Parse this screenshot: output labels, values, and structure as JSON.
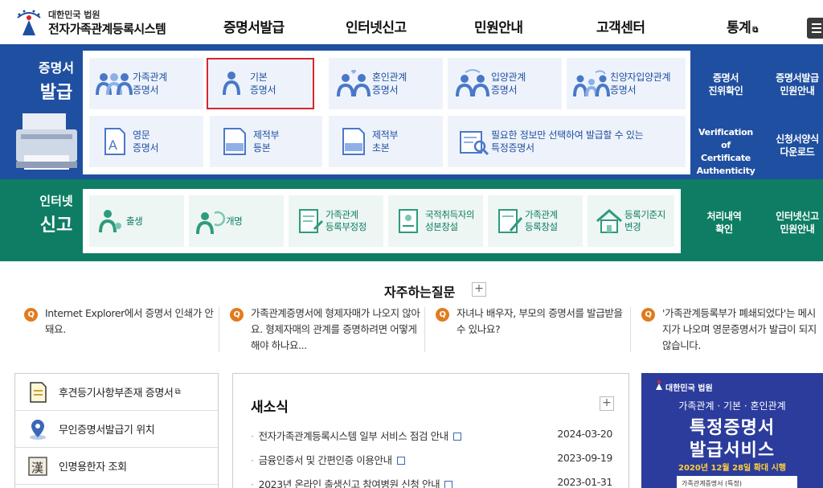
{
  "header": {
    "logo_top": "대한민국 법원",
    "logo_main": "전자가족관계등록시스템",
    "nav": [
      {
        "label": "증명서발급"
      },
      {
        "label": "인터넷신고"
      },
      {
        "label": "민원안내"
      },
      {
        "label": "고객센터"
      },
      {
        "label": "통계"
      }
    ]
  },
  "issuance": {
    "title_top": "증명서",
    "title_bottom": "발급",
    "tiles": [
      {
        "label": "가족관계\n증명서",
        "icon": "family-group-icon"
      },
      {
        "label": "기본\n증명서",
        "icon": "person-icon",
        "selected": true
      },
      {
        "label": "혼인관계\n증명서",
        "icon": "couple-heart-icon"
      },
      {
        "label": "입양관계\n증명서",
        "icon": "adoption-icon"
      },
      {
        "label": "친양자입양관계\n증명서",
        "icon": "full-adoption-icon"
      },
      {
        "label": "영문\n증명서",
        "icon": "english-doc-icon"
      },
      {
        "label": "제적부\n등본",
        "icon": "removed-register-icon"
      },
      {
        "label": "제적부\n초본",
        "icon": "removed-register-icon"
      },
      {
        "label": "필요한 정보만 선택하여 발급할 수 있는\n특정증명서",
        "icon": "search-doc-icon"
      }
    ],
    "side_links": [
      {
        "label": "증명서\n진위확인"
      },
      {
        "label": "증명서발급\n민원안내"
      },
      {
        "label": "Verification of\nCertificate\nAuthenticity"
      },
      {
        "label": "신청서양식\n다운로드"
      }
    ]
  },
  "report": {
    "title_top": "인터넷",
    "title_bottom": "신고",
    "tiles": [
      {
        "label": "출생",
        "icon": "birth-icon"
      },
      {
        "label": "개명",
        "icon": "rename-icon"
      },
      {
        "label": "가족관계\n등록부정정",
        "icon": "correction-doc-icon"
      },
      {
        "label": "국적취득자의\n성본창설",
        "icon": "nationality-doc-icon"
      },
      {
        "label": "가족관계\n등록창설",
        "icon": "register-doc-icon"
      },
      {
        "label": "등록기준지\n변경",
        "icon": "house-icon"
      }
    ],
    "side_links": [
      {
        "label": "처리내역\n확인"
      },
      {
        "label": "인터넷신고\n민원안내"
      }
    ]
  },
  "faq": {
    "title": "자주하는질문",
    "plus": "+",
    "items": [
      {
        "text": "Internet Explorer에서 증명서 인쇄가 안돼요."
      },
      {
        "text": "가족관계증명서에 형제자매가 나오지 않아요. 형제자매의 관계를 증명하려면 어떻게 해야 하나요..."
      },
      {
        "text": "자녀나 배우자, 부모의 증명서를 발급받을 수 있나요?"
      },
      {
        "text": "'가족관계등록부가 폐쇄되었다'는 메시지가 나오며 영문증명서가 발급이 되지 않습니다."
      }
    ],
    "q_mark": "Q"
  },
  "quick_links": [
    {
      "label": "후견등기사항부존재 증명서",
      "icon": "document-icon",
      "external": true
    },
    {
      "label": "무인증명서발급기 위치",
      "icon": "location-pin-icon"
    },
    {
      "label": "인명용한자 조회",
      "icon": "hanja-icon"
    }
  ],
  "news": {
    "title": "새소식",
    "plus": "+",
    "items": [
      {
        "title": "전자가족관계등록시스템 일부 서비스 점검 안내",
        "date": "2024-03-20"
      },
      {
        "title": "금융인증서 및 간편인증 이용안내",
        "date": "2023-09-19"
      },
      {
        "title": "2023년 온라인 출생신고 참여병원 신청 안내",
        "date": "2023-01-31"
      }
    ]
  },
  "banner": {
    "top": "대한민국 법원",
    "sub": "가족관계 · 기본 · 혼인관계",
    "big1": "특정증명서",
    "big2": "발급서비스",
    "date": "2020년 12월 28일 확대 시행",
    "strip": "가족관계증명서     (특정)"
  },
  "colors": {
    "issuance_band": "#1f4fa0",
    "report_band": "#0e7d63",
    "selected_outline": "#d7262c",
    "faq_badge": "#e07c1e"
  }
}
